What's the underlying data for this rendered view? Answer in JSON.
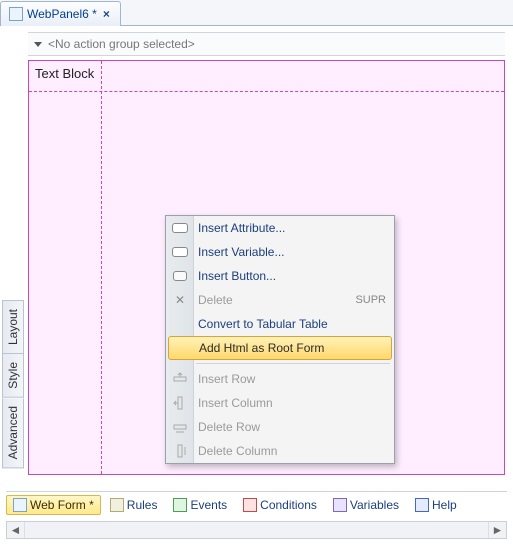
{
  "top_tab": {
    "title": "WebPanel6 *"
  },
  "action_bar": {
    "text": "<No action group selected>"
  },
  "canvas": {
    "textblock_label": "Text Block"
  },
  "left_tabs": {
    "layout": "Layout",
    "style": "Style",
    "advanced": "Advanced"
  },
  "context_menu": {
    "insert_attribute": "Insert Attribute...",
    "insert_variable": "Insert Variable...",
    "insert_button": "Insert Button...",
    "delete": "Delete",
    "delete_shortcut": "SUPR",
    "convert": "Convert to Tabular Table",
    "add_html": "Add Html as Root Form",
    "insert_row": "Insert Row",
    "insert_column": "Insert Column",
    "delete_row": "Delete Row",
    "delete_column": "Delete Column"
  },
  "bottom_tabs": {
    "webform": "Web Form *",
    "rules": "Rules",
    "events": "Events",
    "conditions": "Conditions",
    "variables": "Variables",
    "help": "Help"
  }
}
